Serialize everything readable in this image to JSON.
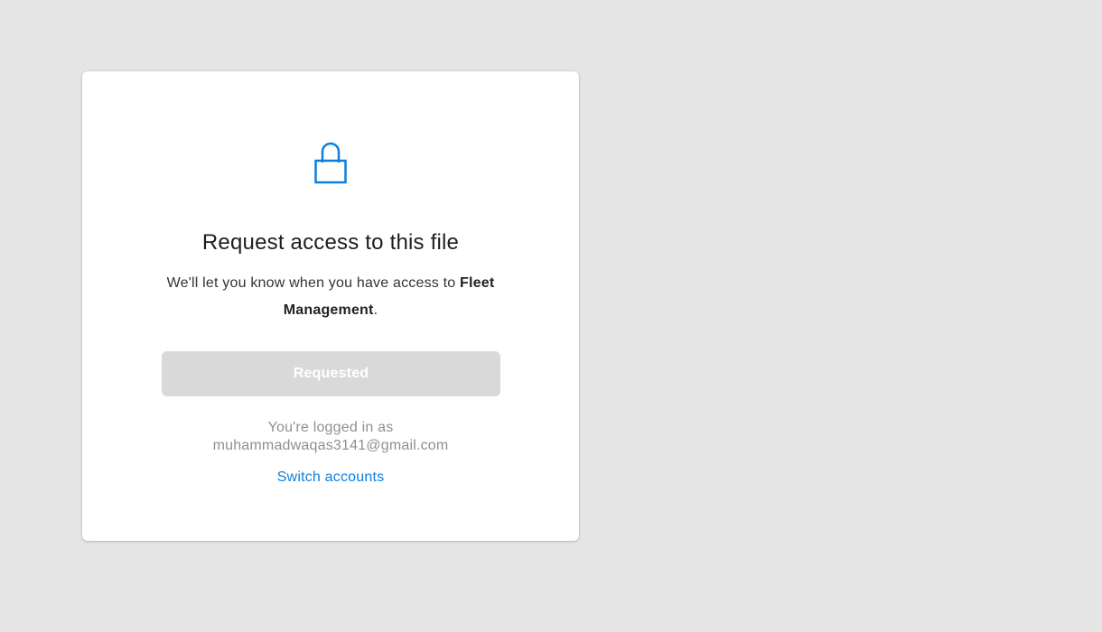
{
  "colors": {
    "page_background": "#e5e5e5",
    "card_background": "#ffffff",
    "accent": "#0d7fdb",
    "button_disabled": "#d9d9d9",
    "muted_text": "#8f8f8f"
  },
  "icon": {
    "name": "lock-icon"
  },
  "dialog": {
    "title": "Request access to this file",
    "description_prefix": "We'll let you know when you have access to ",
    "file_name": "Fleet Management",
    "description_suffix": ".",
    "button_label": "Requested",
    "logged_in_prefix": "You're logged in as",
    "email": "muhammadwaqas3141@gmail.com",
    "switch_label": "Switch accounts"
  }
}
